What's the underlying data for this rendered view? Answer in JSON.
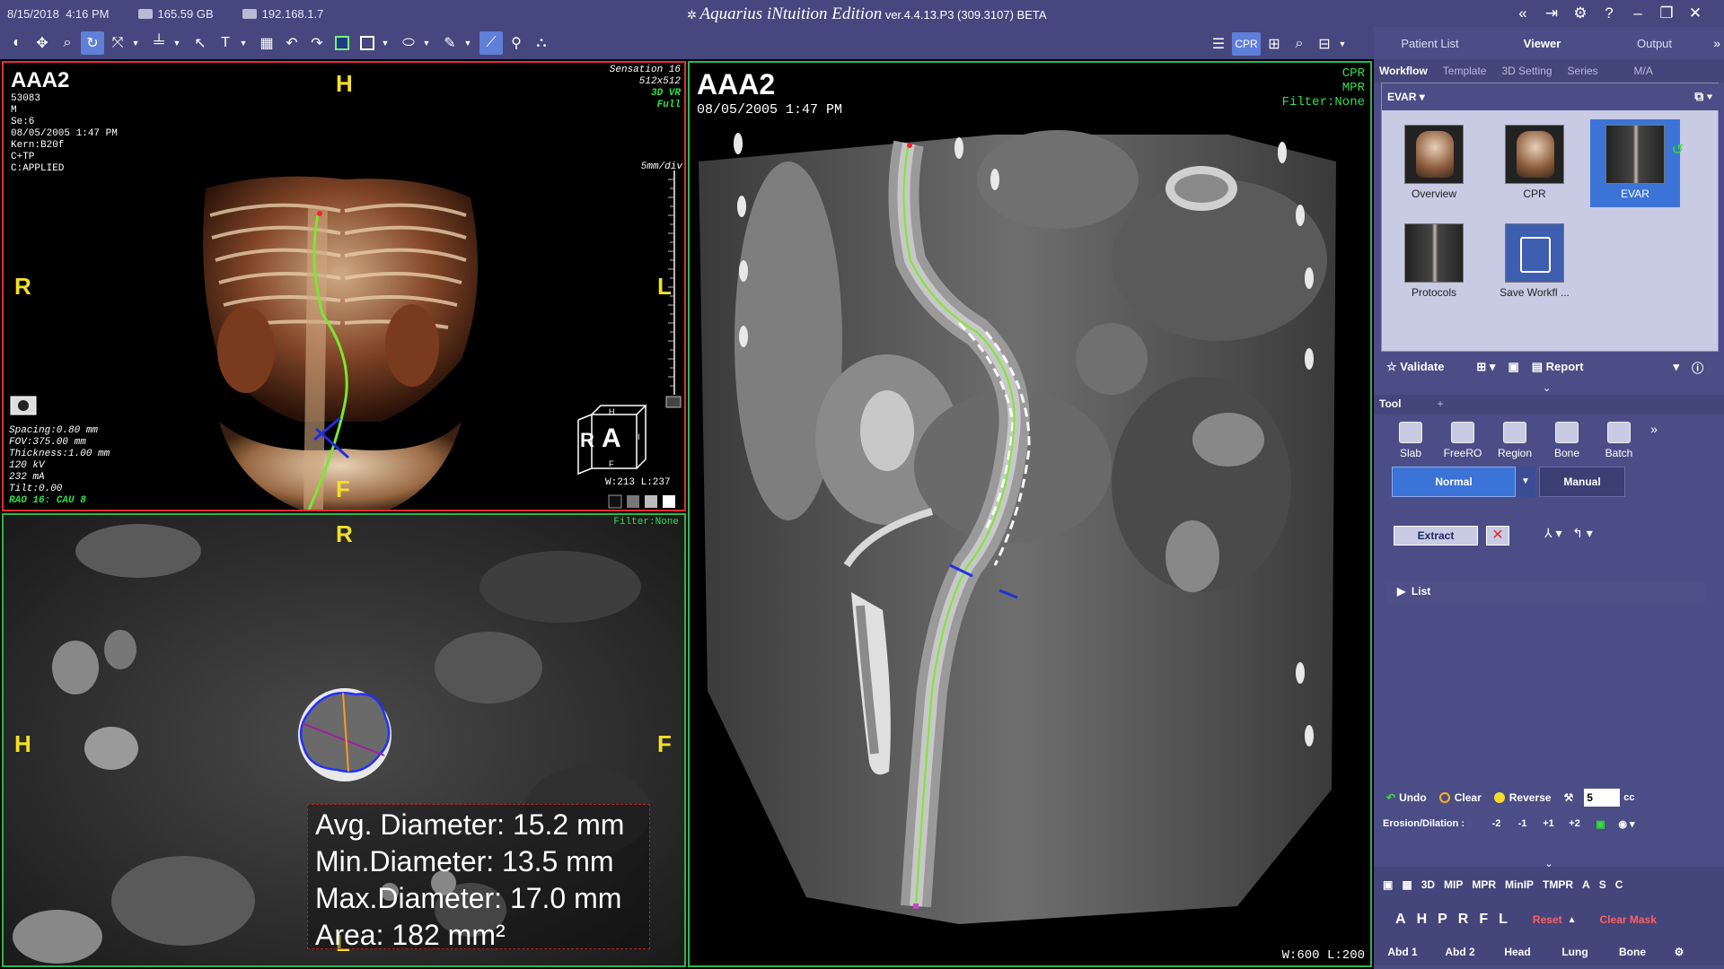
{
  "status": {
    "date": "8/15/2018",
    "time": "4:16 PM",
    "disk": "165.59 GB",
    "ip": "192.168.1.7"
  },
  "app": {
    "title": "Aquarius iNtuition Edition",
    "version": "ver.4.4.13.P3 (309.3107) BETA"
  },
  "nav": {
    "tabs": [
      "Patient List",
      "Viewer",
      "Output"
    ],
    "active": "Viewer"
  },
  "subtabs": [
    "Workflow",
    "Template",
    "3D Setting",
    "Series",
    "M/A"
  ],
  "workflow": {
    "name": "EVAR",
    "items": [
      {
        "label": "Overview"
      },
      {
        "label": "CPR"
      },
      {
        "label": "EVAR"
      },
      {
        "label": "Protocols"
      },
      {
        "label": "Save Workfl ..."
      }
    ]
  },
  "actions": {
    "validate": "Validate",
    "report": "Report"
  },
  "tool": {
    "header": "Tool",
    "items": [
      "Slab",
      "FreeRO",
      "Region",
      "Bone",
      "Batch"
    ],
    "normal": "Normal",
    "manual": "Manual",
    "extract": "Extract",
    "list": "List",
    "undo": "Undo",
    "clear": "Clear",
    "reverse": "Reverse",
    "erosion_value": "5",
    "erosion_unit": "cc",
    "erosion_label": "Erosion/Dilation :",
    "erosion_steps": [
      "-2",
      "-1",
      "+1",
      "+2"
    ]
  },
  "modes": {
    "row1": [
      "3D",
      "MIP",
      "MPR",
      "MinIP",
      "TMPR",
      "A",
      "S",
      "C"
    ],
    "orient": [
      "A",
      "H",
      "P",
      "R",
      "F",
      "L"
    ],
    "reset": "Reset",
    "clear_mask": "Clear Mask",
    "presets": [
      "Abd 1",
      "Abd 2",
      "Head",
      "Lung",
      "Bone"
    ]
  },
  "vp1": {
    "title": "AAA2",
    "patient_lines": [
      "53083",
      "M",
      "Se:6",
      "08/05/2005 1:47 PM",
      "Kern:B20f",
      "C+TP",
      "C:APPLIED"
    ],
    "scanner_lines": [
      "Sensation 16",
      "512x512"
    ],
    "mode_lines": [
      "3D VR",
      "Full"
    ],
    "scale": "5mm/div",
    "orient": {
      "top": "H",
      "left": "R",
      "right": "L",
      "bottom": "F"
    },
    "params": [
      "Spacing:0.80 mm",
      "FOV:375.00 mm",
      "Thickness:1.00 mm",
      "120 kV",
      "232 mA",
      "Tilt:0.00"
    ],
    "angle": "RAO 16: CAU 8",
    "wl": "W:213 L:237",
    "cube": {
      "front": "A",
      "top": "H",
      "left": "R",
      "right": "I",
      "bottom": "F"
    }
  },
  "vp2": {
    "filter": "Filter:None",
    "orient": {
      "top": "R",
      "left": "H",
      "right": "F",
      "bottom": "L"
    },
    "measurements": [
      "Avg. Diameter: 15.2 mm",
      "Min.Diameter: 13.5 mm",
      "Max.Diameter: 17.0 mm",
      "Area: 182 mm²"
    ]
  },
  "vp3": {
    "title": "AAA2",
    "date": "08/05/2005 1:47 PM",
    "modes": [
      "CPR",
      "MPR",
      "Filter:None"
    ],
    "wl": "W:600 L:200"
  }
}
